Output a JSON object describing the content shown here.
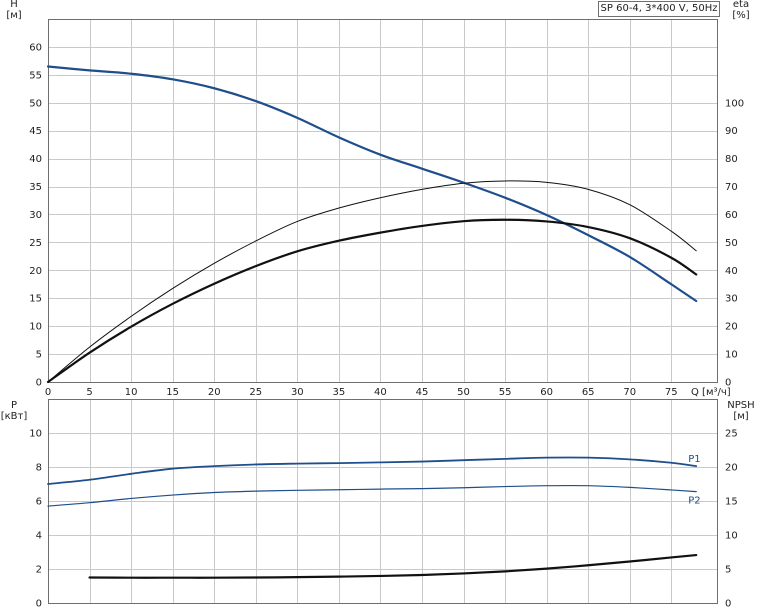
{
  "chart_data": [
    {
      "type": "line",
      "title": "SP 60-4, 3*400 V, 50Hz",
      "x_label": "Q [м³/ч]",
      "x_ticks": [
        0,
        5,
        10,
        15,
        20,
        25,
        30,
        35,
        40,
        45,
        50,
        55,
        60,
        65,
        70,
        75
      ],
      "xlim": [
        0,
        80.5
      ],
      "y_label_left": "H",
      "y_unit_left": "[м]",
      "y_ticks_left": [
        0,
        5,
        10,
        15,
        20,
        25,
        30,
        35,
        40,
        45,
        50,
        55,
        60
      ],
      "ylim_left": [
        0,
        65
      ],
      "y_label_right": "eta",
      "y_unit_right": "[%]",
      "y_ticks_right": [
        0,
        10,
        20,
        30,
        40,
        50,
        60,
        70,
        80,
        90,
        100
      ],
      "ylim_right": [
        0,
        130
      ],
      "grid": true,
      "series": [
        {
          "axis": "left",
          "color": "#1f4e8c",
          "width": 2.2,
          "x": [
            0,
            5,
            10,
            15,
            20,
            25,
            30,
            35,
            40,
            45,
            50,
            55,
            60,
            65,
            70,
            75,
            78
          ],
          "y": [
            56.5,
            55.8,
            55.2,
            54.2,
            52.6,
            50.3,
            47.3,
            43.8,
            40.7,
            38.2,
            35.7,
            33.0,
            29.9,
            26.3,
            22.4,
            17.5,
            14.5
          ]
        },
        {
          "axis": "right",
          "color": "#111111",
          "width": 2.2,
          "x": [
            0,
            5,
            10,
            15,
            20,
            25,
            30,
            35,
            40,
            45,
            50,
            55,
            60,
            65,
            70,
            75,
            78
          ],
          "y": [
            0,
            10.5,
            19.8,
            28,
            35.2,
            41.5,
            46.8,
            50.6,
            53.5,
            55.9,
            57.6,
            58.1,
            57.5,
            55.5,
            51.5,
            44.5,
            38.5
          ]
        },
        {
          "axis": "right",
          "color": "#111111",
          "width": 1.0,
          "x": [
            0,
            5,
            10,
            15,
            20,
            25,
            30,
            35,
            40,
            45,
            50,
            55,
            60,
            65,
            70,
            75,
            78
          ],
          "y": [
            0,
            12.5,
            23.5,
            33.5,
            42.5,
            50.5,
            57.5,
            62.3,
            66.0,
            69.0,
            71.2,
            72.0,
            71.5,
            69.0,
            63.5,
            54.0,
            47.0
          ]
        }
      ]
    },
    {
      "type": "line",
      "x_ticks": [
        0,
        5,
        10,
        15,
        20,
        25,
        30,
        35,
        40,
        45,
        50,
        55,
        60,
        65,
        70,
        75
      ],
      "xlim": [
        0,
        80.5
      ],
      "y_label_left": "P",
      "y_unit_left": "[кВт]",
      "y_ticks_left": [
        0,
        2,
        4,
        6,
        8,
        10
      ],
      "ylim_left": [
        0,
        12
      ],
      "y_label_right": "NPSH",
      "y_unit_right": "[м]",
      "y_ticks_right": [
        0,
        5,
        10,
        15,
        20,
        25
      ],
      "ylim_right": [
        0,
        30
      ],
      "grid": true,
      "series": [
        {
          "name": "P1",
          "axis": "left",
          "color": "#1f4e8c",
          "width": 1.8,
          "x": [
            0,
            5,
            10,
            15,
            20,
            25,
            30,
            35,
            40,
            45,
            50,
            55,
            60,
            65,
            70,
            75,
            78
          ],
          "y": [
            7.0,
            7.25,
            7.6,
            7.9,
            8.05,
            8.15,
            8.2,
            8.23,
            8.27,
            8.32,
            8.4,
            8.48,
            8.55,
            8.55,
            8.45,
            8.25,
            8.05
          ]
        },
        {
          "name": "P2",
          "axis": "left",
          "color": "#1f4e8c",
          "width": 1.2,
          "x": [
            0,
            5,
            10,
            15,
            20,
            25,
            30,
            35,
            40,
            45,
            50,
            55,
            60,
            65,
            70,
            75,
            78
          ],
          "y": [
            5.7,
            5.9,
            6.15,
            6.35,
            6.5,
            6.58,
            6.63,
            6.66,
            6.7,
            6.73,
            6.78,
            6.85,
            6.9,
            6.9,
            6.8,
            6.65,
            6.55
          ]
        },
        {
          "axis": "right",
          "color": "#111111",
          "width": 2.2,
          "x": [
            5,
            10,
            15,
            20,
            25,
            30,
            35,
            40,
            45,
            50,
            55,
            60,
            65,
            70,
            75,
            78
          ],
          "y": [
            3.75,
            3.72,
            3.72,
            3.72,
            3.75,
            3.8,
            3.88,
            3.98,
            4.12,
            4.35,
            4.65,
            5.05,
            5.55,
            6.1,
            6.7,
            7.05
          ]
        }
      ]
    }
  ]
}
